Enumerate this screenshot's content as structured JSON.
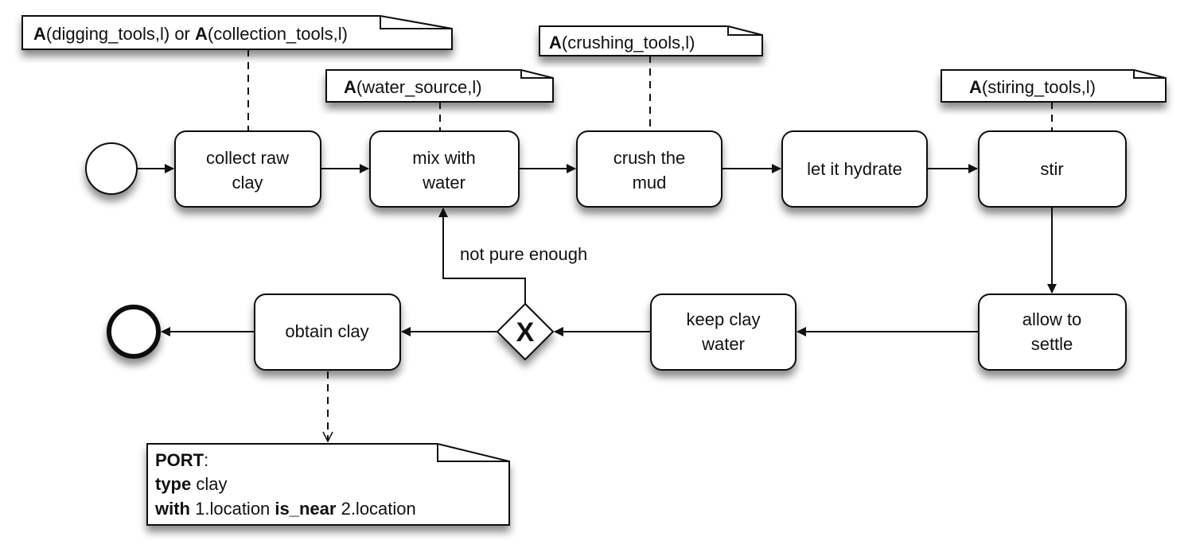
{
  "diagram": {
    "tasks": {
      "collect": [
        "collect raw",
        "clay"
      ],
      "mix": [
        "mix with",
        "water"
      ],
      "crush": [
        "crush the",
        "mud"
      ],
      "hydrate": "let it hydrate",
      "stir": "stir",
      "settle": [
        "allow to",
        "settle"
      ],
      "keep": [
        "keep clay",
        "water"
      ],
      "obtain": "obtain clay"
    },
    "gateway": {
      "type": "exclusive",
      "symbol": "X"
    },
    "loop_label": "not pure enough",
    "annotations": {
      "collect": {
        "b1": "A",
        "t1": "(digging_tools,l) or ",
        "b2": "A",
        "t2": "(collection_tools,l)"
      },
      "mix": {
        "b": "A",
        "t": "(water_source,l)"
      },
      "crush": {
        "b": "A",
        "t": "(crushing_tools,l)"
      },
      "stir": {
        "b": "A",
        "t": "(stiring_tools,l)"
      }
    },
    "port_note": {
      "l1b": "PORT",
      "l1t": ":",
      "l2b": "type",
      "l2t": " clay",
      "l3b1": "with",
      "l3t1": " 1.location ",
      "l3b2": "is_near",
      "l3t2": " 2.location"
    }
  }
}
